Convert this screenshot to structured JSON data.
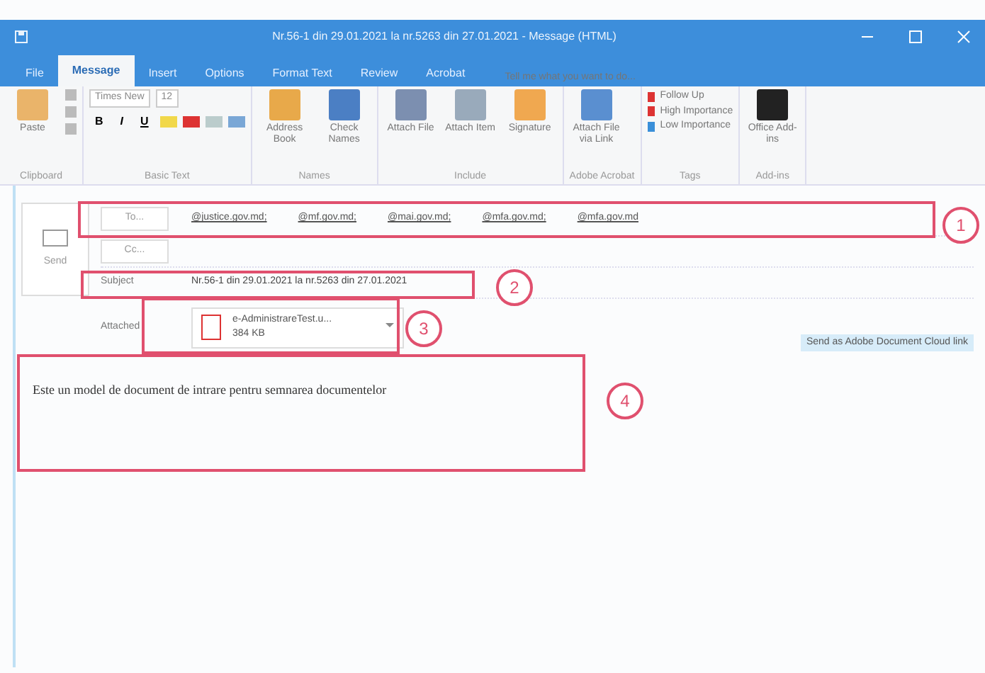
{
  "window": {
    "title": "Nr.56-1 din 29.01.2021 la nr.5263 din 27.01.2021 - Message (HTML)"
  },
  "tabs": [
    {
      "label": "File",
      "selected": false
    },
    {
      "label": "Message",
      "selected": true
    },
    {
      "label": "Insert",
      "selected": false
    },
    {
      "label": "Options",
      "selected": false
    },
    {
      "label": "Format Text",
      "selected": false
    },
    {
      "label": "Review",
      "selected": false
    },
    {
      "label": "Acrobat",
      "selected": false
    }
  ],
  "tell_me": {
    "placeholder": "Tell me what you want to do..."
  },
  "ribbon": {
    "groups": [
      {
        "name": "Clipboard",
        "kind": "clipboard",
        "items": [
          "Paste"
        ]
      },
      {
        "name": "Basic Text",
        "kind": "font",
        "font": "Times New",
        "size": "12",
        "items": [
          "B",
          "I",
          "U"
        ]
      },
      {
        "name": "Names",
        "kind": "big",
        "items": [
          "Address Book",
          "Check Names"
        ]
      },
      {
        "name": "Include",
        "kind": "big",
        "items": [
          "Attach File",
          "Attach Item",
          "Signature"
        ]
      },
      {
        "name": "Adobe Acrobat",
        "kind": "big",
        "items": [
          "Attach File via Link"
        ]
      },
      {
        "name": "Tags",
        "kind": "list",
        "items": [
          "Follow Up",
          "High Importance",
          "Low Importance"
        ]
      },
      {
        "name": "Add-ins",
        "kind": "big",
        "items": [
          "Office Add-ins"
        ]
      }
    ]
  },
  "compose": {
    "send": "Send",
    "to_label": "To...",
    "recipients": [
      "@justice.gov.md;",
      "@mf.gov.md;",
      "@mai.gov.md;",
      "@mfa.gov.md;",
      "@mfa.gov.md"
    ],
    "cc_label": "Cc...",
    "subject_label": "Subject",
    "subject": "Nr.56-1 din 29.01.2021 la nr.5263 din 27.01.2021",
    "attached_label": "Attached",
    "attachment": {
      "name": "e-AdministrareTest.u...",
      "size": "384 KB"
    },
    "cloud_link": "Send as Adobe Document Cloud link",
    "body": "Este un model de document de intrare pentru semnarea documentelor"
  },
  "annotations": [
    {
      "number": "1"
    },
    {
      "number": "2"
    },
    {
      "number": "3"
    },
    {
      "number": "4"
    }
  ]
}
